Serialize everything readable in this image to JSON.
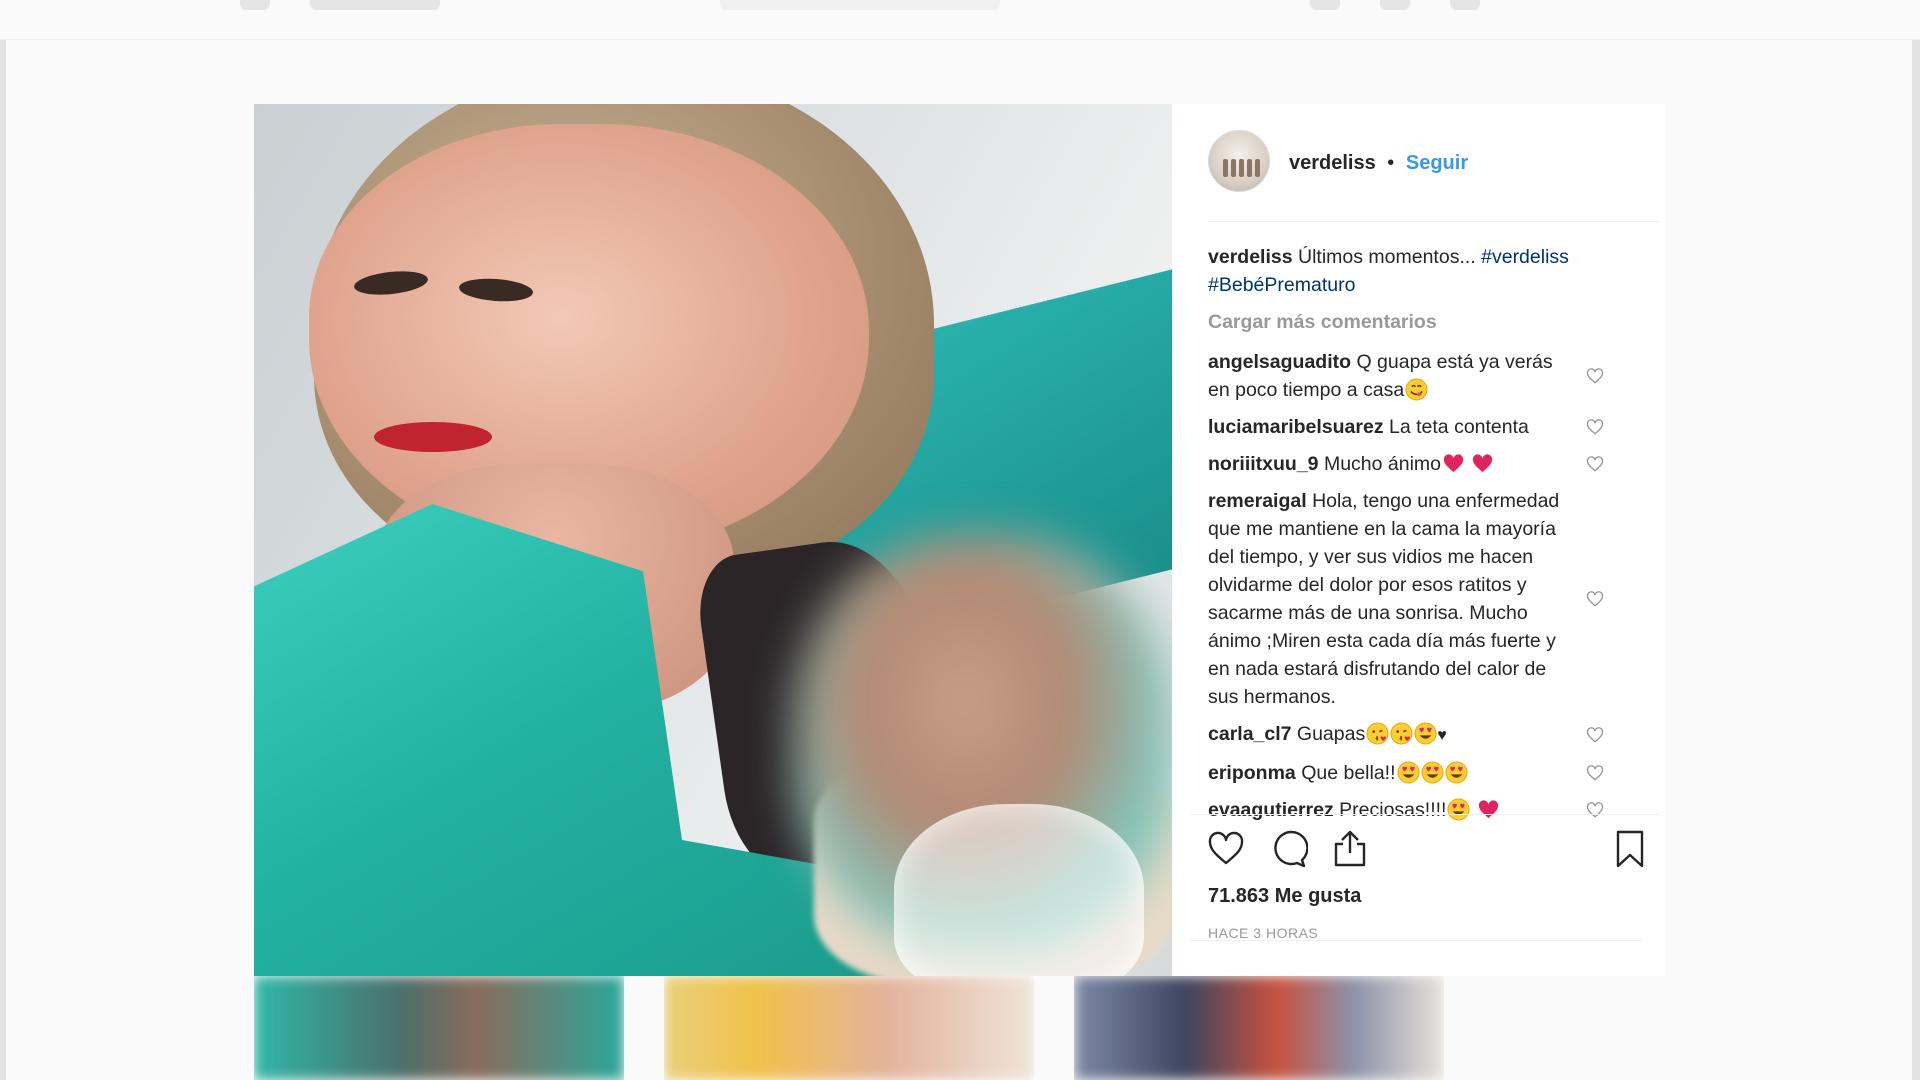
{
  "post": {
    "username": "verdeliss",
    "separator": "•",
    "follow_label": "Seguir",
    "caption": {
      "author": "verdeliss",
      "text": "Últimos momentos...",
      "hashtags": [
        "#verdeliss",
        "#BebéPrematuro"
      ]
    },
    "load_more_label": "Cargar más comentarios",
    "comments": [
      {
        "author": "angelsaguadito",
        "text": "Q guapa está ya verás en poco tiempo a casa",
        "emojis": [
          "yum-face"
        ]
      },
      {
        "author": "luciamaribelsuarez",
        "text": "La teta contenta",
        "emojis": []
      },
      {
        "author": "noriiitxuu_9",
        "text": "Mucho ánimo",
        "emojis": [
          "red-heart",
          "red-heart"
        ]
      },
      {
        "author": "remeraigal",
        "text": "Hola, tengo una enfermedad que me mantiene en la cama la mayoría del tiempo, y ver sus vidios me hacen olvidarme del dolor por esos ratitos y sacarme más de una sonrisa. Mucho ánimo ;Miren esta cada día más fuerte y en nada estará disfrutando del calor de sus hermanos.",
        "emojis": []
      },
      {
        "author": "carla_cl7",
        "text": "Guapas",
        "emojis": [
          "kissing-face",
          "kissing-face",
          "heart-eyes"
        ],
        "trailing": "♥"
      },
      {
        "author": "eriponma",
        "text": "Que bella!!",
        "emojis": [
          "heart-eyes",
          "heart-eyes",
          "heart-eyes"
        ]
      },
      {
        "author": "evaagutierrez",
        "text": "Preciosas!!!!",
        "emojis": [
          "heart-eyes",
          "red-heart"
        ]
      }
    ],
    "likes": "71.863 Me gusta",
    "time": "Hace 3 horas",
    "icons": {
      "like": "heart-outline-icon",
      "comment": "comment-bubble-icon",
      "share": "share-icon",
      "save": "bookmark-icon"
    },
    "colors": {
      "link": "#3897f0",
      "hashtag": "#003569",
      "muted": "#999999",
      "text": "#262626"
    }
  }
}
